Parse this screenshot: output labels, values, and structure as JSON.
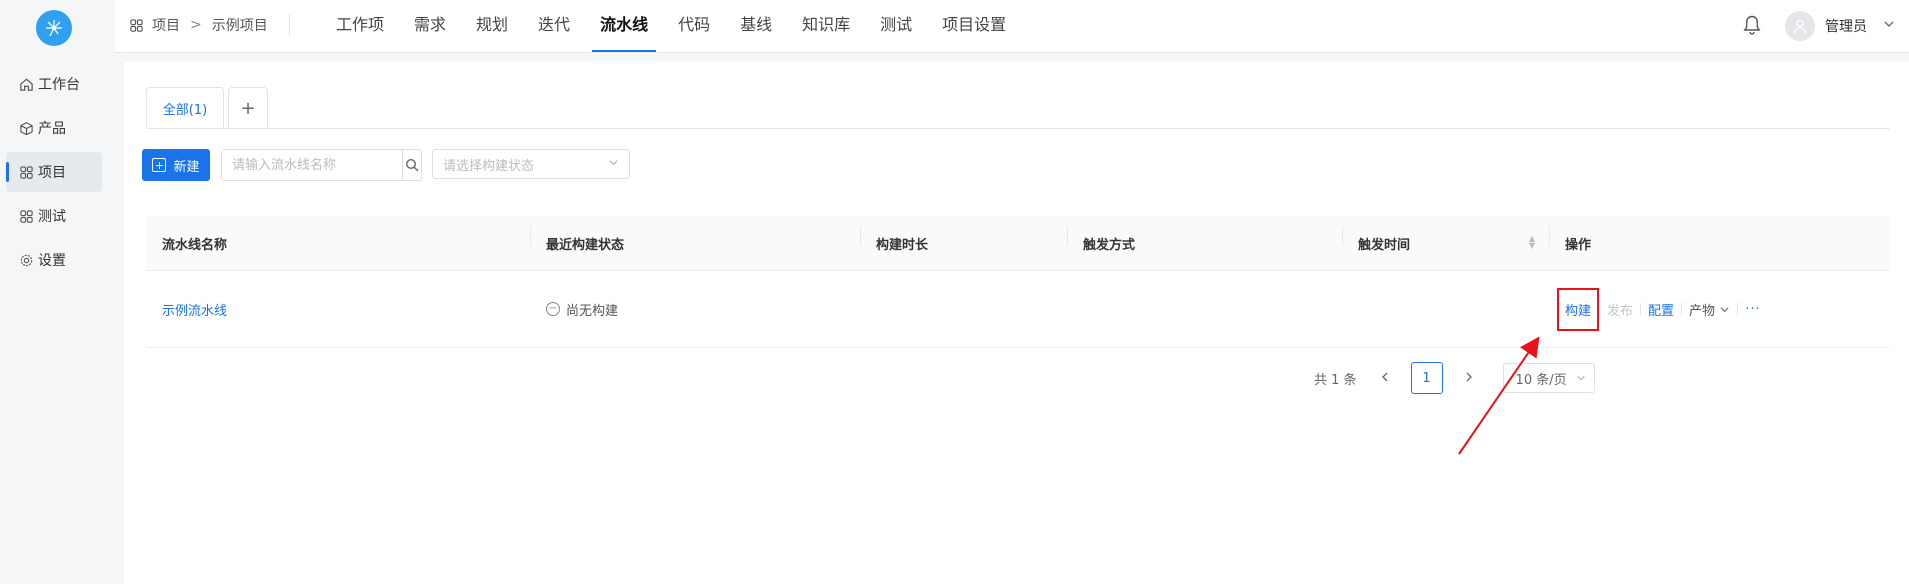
{
  "sidebar": {
    "logo_icon": "dandelion-logo",
    "items": [
      {
        "label": "工作台",
        "icon": "home-icon",
        "active": false
      },
      {
        "label": "产品",
        "icon": "cube-icon",
        "active": false
      },
      {
        "label": "项目",
        "icon": "grid-icon",
        "active": true
      },
      {
        "label": "测试",
        "icon": "grid-icon",
        "active": false
      },
      {
        "label": "设置",
        "icon": "gear-icon",
        "active": false
      }
    ]
  },
  "header": {
    "breadcrumb": {
      "root": "项目",
      "separator": ">",
      "current": "示例项目"
    },
    "tabs": [
      "工作项",
      "需求",
      "规划",
      "迭代",
      "流水线",
      "代码",
      "基线",
      "知识库",
      "测试",
      "项目设置"
    ],
    "active_tab": "流水线",
    "user": {
      "name": "管理员"
    }
  },
  "main": {
    "group_tabs": {
      "all": "全部(1)",
      "add": "+"
    },
    "new_button": "新建",
    "search": {
      "placeholder": "请输入流水线名称"
    },
    "status_filter": {
      "placeholder": "请选择构建状态"
    },
    "table": {
      "columns": [
        "流水线名称",
        "最近构建状态",
        "构建时长",
        "触发方式",
        "触发时间",
        "操作"
      ],
      "rows": [
        {
          "name": "示例流水线",
          "status": "尚无构建",
          "duration": "",
          "trigger": "",
          "trigger_time": "",
          "ops": {
            "build": "构建",
            "publish": "发布",
            "config": "配置",
            "product": "产物",
            "more": "···"
          }
        }
      ]
    },
    "pagination": {
      "total": "共 1 条",
      "current_page": "1",
      "page_size": "10 条/页"
    }
  },
  "colors": {
    "accent": "#1a73e8",
    "highlight_box": "#e8141a",
    "annotation_arrow": "#e8141a"
  }
}
